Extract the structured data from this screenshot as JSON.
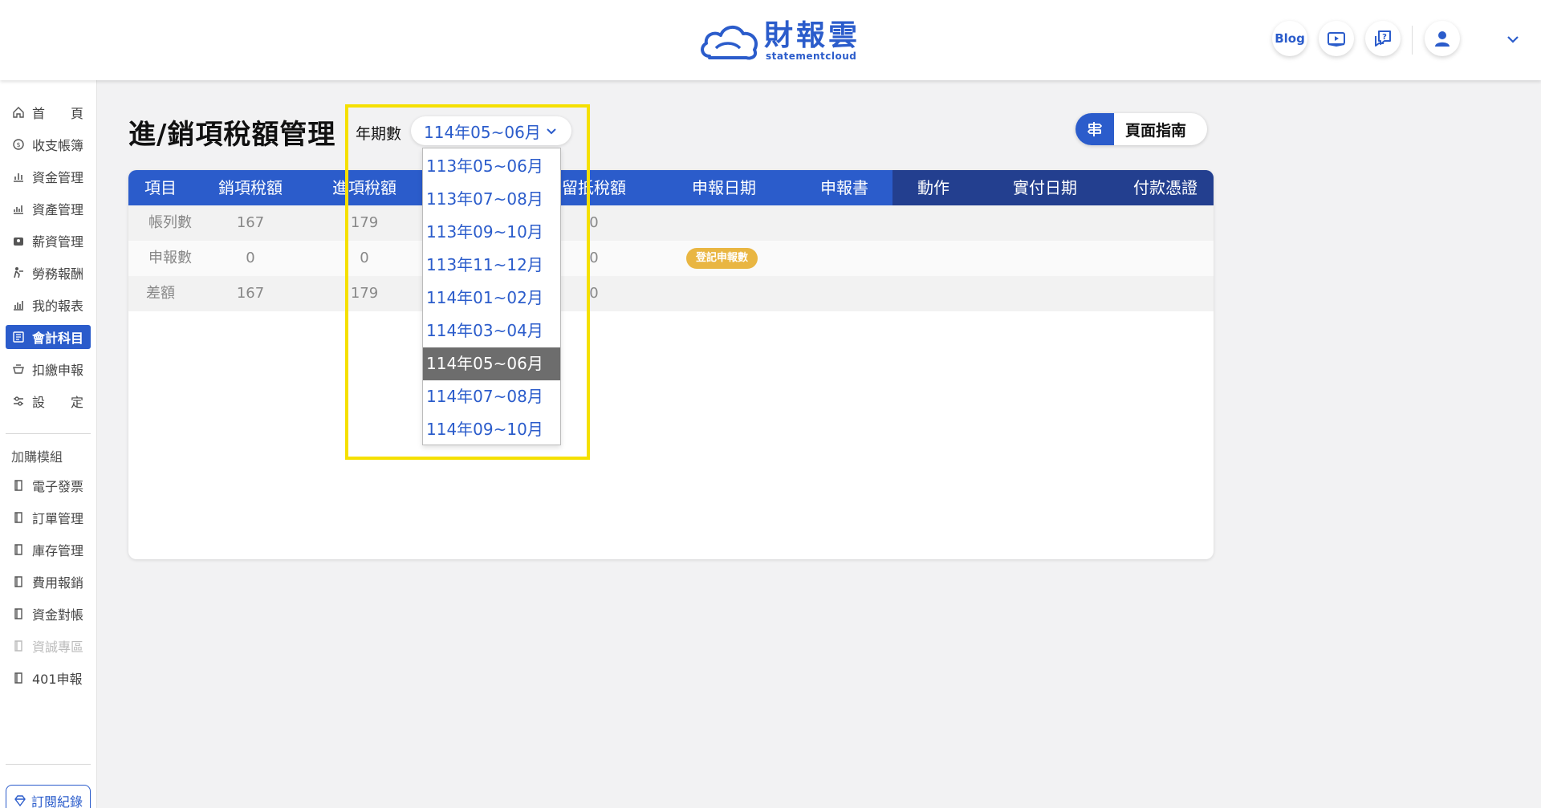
{
  "header": {
    "brand_cn": "財報雲",
    "brand_en": "statementcloud",
    "blog_label": "Blog"
  },
  "sidebar": {
    "items": [
      {
        "label": "首　　頁"
      },
      {
        "label": "收支帳簿"
      },
      {
        "label": "資金管理"
      },
      {
        "label": "資產管理"
      },
      {
        "label": "薪資管理"
      },
      {
        "label": "勞務報酬"
      },
      {
        "label": "我的報表"
      },
      {
        "label": "會計科目",
        "active": true
      },
      {
        "label": "扣繳申報"
      },
      {
        "label": "設　　定"
      }
    ],
    "addon_section": "加購模組",
    "addons": [
      {
        "label": "電子發票"
      },
      {
        "label": "訂單管理"
      },
      {
        "label": "庫存管理"
      },
      {
        "label": "費用報銷"
      },
      {
        "label": "資金對帳"
      },
      {
        "label": "資誠專區",
        "disabled": true
      },
      {
        "label": "401申報"
      }
    ],
    "subscription_label": "訂閱紀錄"
  },
  "page": {
    "title": "進/銷項稅額管理",
    "period_label": "年期數",
    "period_selected": "114年05~06月",
    "guide_label": "頁面指南"
  },
  "table": {
    "headers": [
      "項目",
      "銷項稅額",
      "進項稅額",
      "留抵稅額",
      "申報日期",
      "申報書",
      "動作",
      "實付日期",
      "付款憑證"
    ],
    "rows": [
      {
        "item": "帳列數",
        "sales_tax": "167",
        "input_tax": "179",
        "credit": "0"
      },
      {
        "item": "申報數",
        "sales_tax": "0",
        "input_tax": "0",
        "credit": "0",
        "action_badge": "登記申報數"
      },
      {
        "item": "差額",
        "sales_tax": "167",
        "input_tax": "179",
        "credit": "0"
      }
    ]
  },
  "dropdown": {
    "options": [
      "113年05~06月",
      "113年07~08月",
      "113年09~10月",
      "113年11~12月",
      "114年01~02月",
      "114年03~04月",
      "114年05~06月",
      "114年07~08月",
      "114年09~10月"
    ],
    "selected_index": 6
  },
  "colors": {
    "brand": "#2b5ccb",
    "header_dark": "#233f8f",
    "badge": "#e9b642",
    "highlight": "#f5e000"
  }
}
